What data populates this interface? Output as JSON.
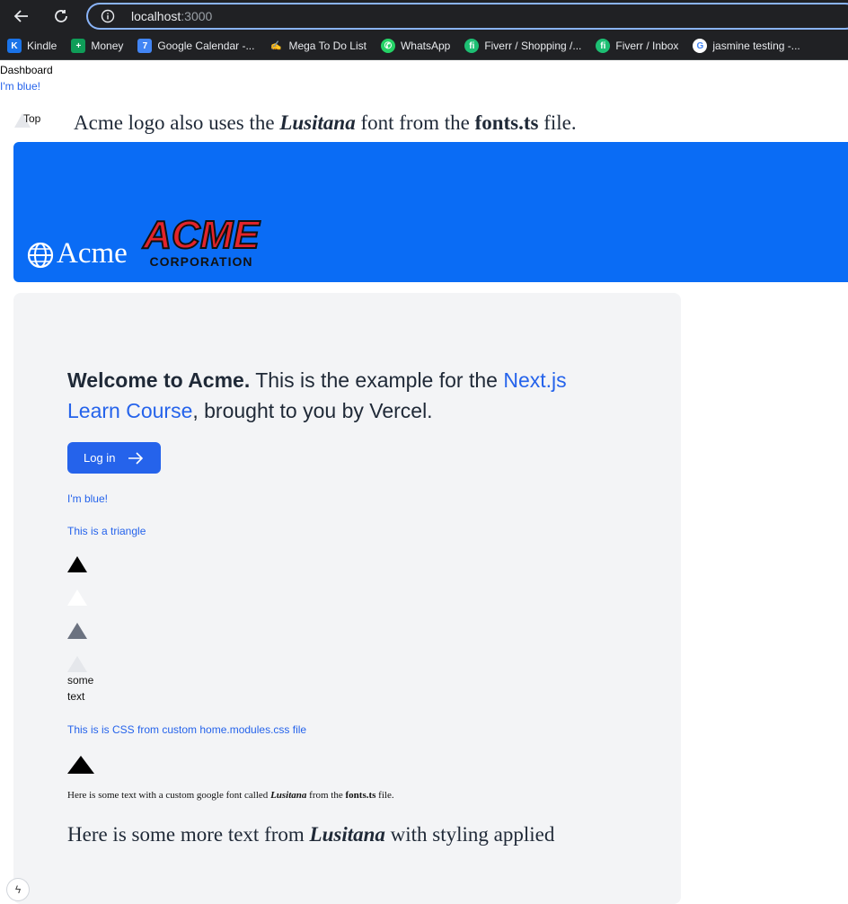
{
  "browser": {
    "url_host": "localhost",
    "url_port": ":3000",
    "bookmarks": [
      {
        "label": "Kindle",
        "icon": "kindle-icon",
        "color": "#1a73e8"
      },
      {
        "label": "Money",
        "icon": "sheets-icon",
        "color": "#0f9d58"
      },
      {
        "label": "Google Calendar -...",
        "icon": "calendar-icon",
        "color": "#4285f4"
      },
      {
        "label": "Mega To Do List",
        "icon": "hand-icon",
        "color": "#f4b400"
      },
      {
        "label": "WhatsApp",
        "icon": "whatsapp-icon",
        "color": "#25d366"
      },
      {
        "label": "Fiverr / Shopping /...",
        "icon": "fiverr-icon",
        "color": "#1dbf73"
      },
      {
        "label": "Fiverr / Inbox",
        "icon": "fiverr-icon",
        "color": "#1dbf73"
      },
      {
        "label": "jasmine testing -...",
        "icon": "google-icon",
        "color": "#ffffff"
      }
    ]
  },
  "page": {
    "dashboard": "Dashboard",
    "blue_link": "I'm blue!",
    "top_label": "Top",
    "headline": {
      "pre": "Acme logo also uses the ",
      "font": "Lusitana",
      "mid": " font from the ",
      "file": "fonts.ts",
      "post": " file."
    },
    "banner": {
      "wordmark": "Acme",
      "corp_logo_big": "ACME",
      "corp_logo_small": "CORPORATION",
      "color": "#0a6cf5"
    },
    "welcome": {
      "bold": "Welcome to Acme.",
      "pre": " This is the example for the ",
      "link": "Next.js Learn Course",
      "post": ", brought to you by Vercel."
    },
    "login_button": "Log in",
    "im_blue": "I'm blue!",
    "triangle_label": "This is a triangle",
    "some_text": "some text",
    "css_label": "This is is CSS from custom home.modules.css file",
    "small_serif": {
      "pre": "Here is some text with a custom google font called ",
      "font": "Lusitana",
      "mid": " from the ",
      "file": "fonts.ts",
      "post": " file."
    },
    "big_serif": {
      "pre": "Here is some more text from ",
      "font": "Lusitana",
      "post": " with styling applied"
    },
    "accent": "#2563eb"
  }
}
